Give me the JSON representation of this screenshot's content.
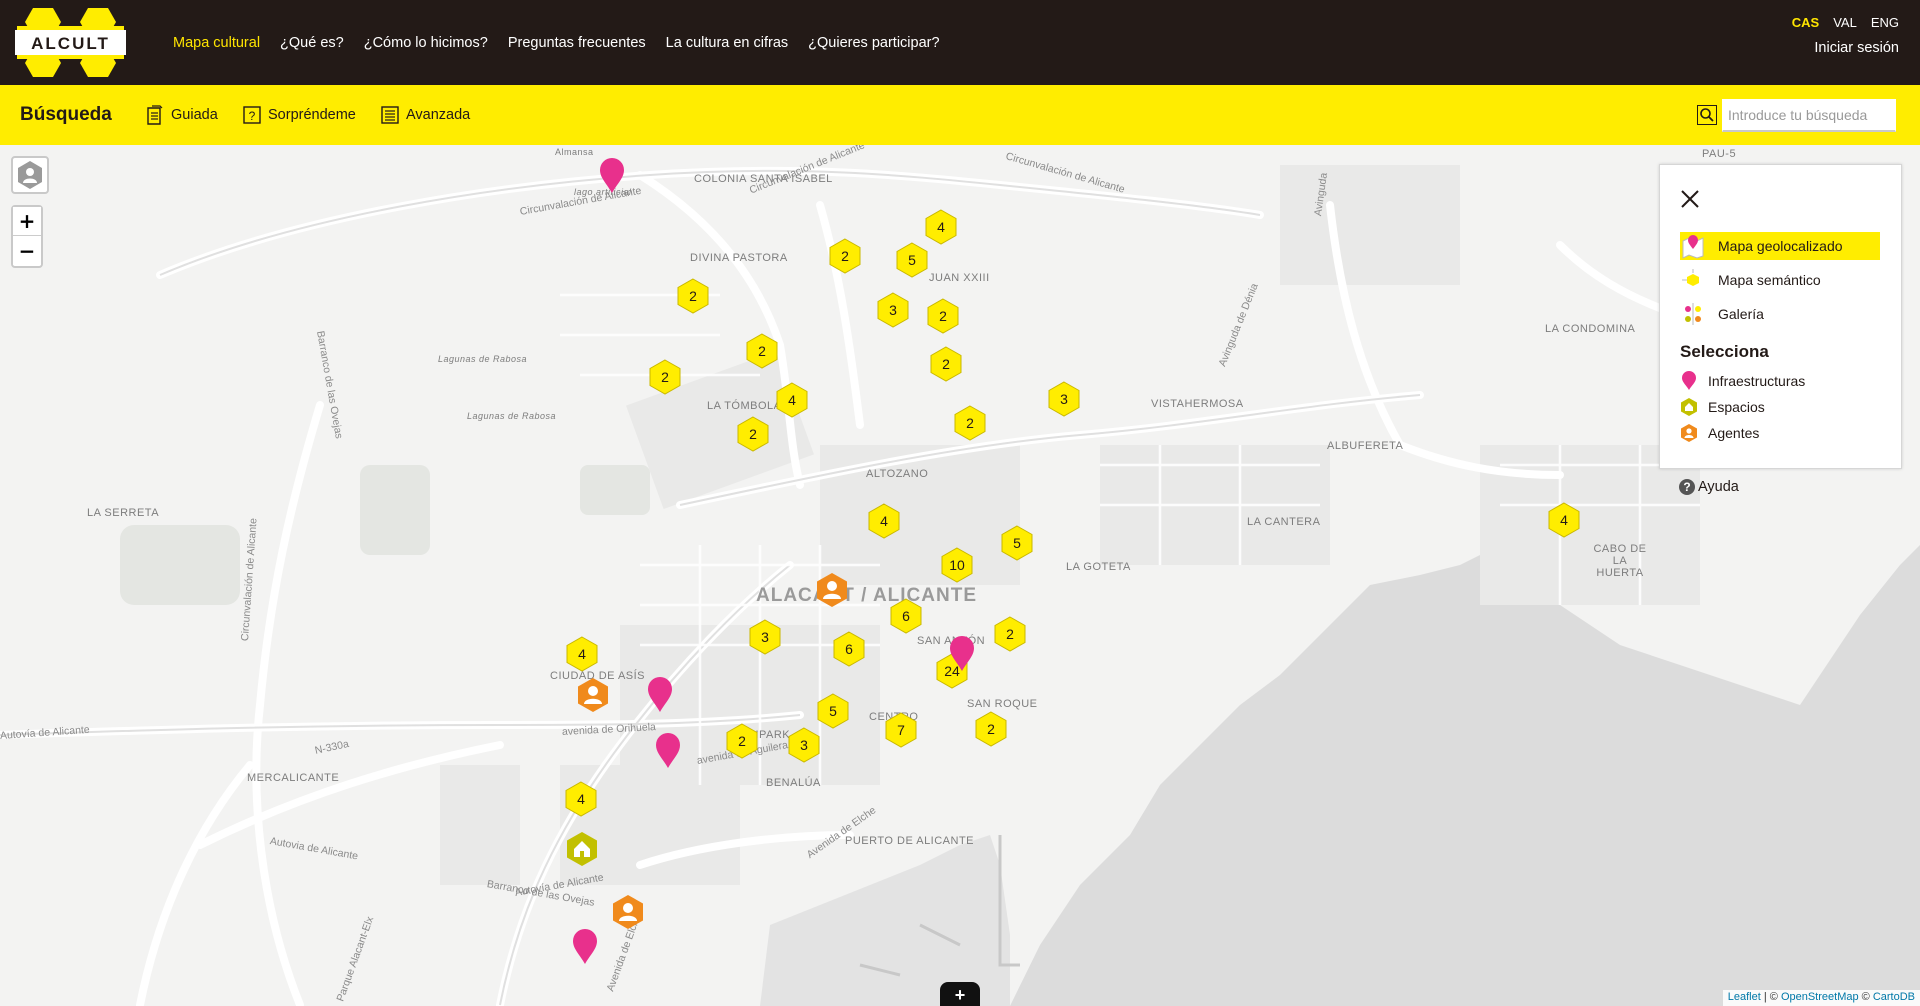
{
  "header": {
    "logo_text": "ALCULT",
    "nav": [
      {
        "label": "Mapa cultural",
        "active": true
      },
      {
        "label": "¿Qué es?",
        "active": false
      },
      {
        "label": "¿Cómo lo hicimos?",
        "active": false
      },
      {
        "label": "Preguntas frecuentes",
        "active": false
      },
      {
        "label": "La cultura en cifras",
        "active": false
      },
      {
        "label": "¿Quieres participar?",
        "active": false
      }
    ],
    "languages": [
      {
        "label": "CAS",
        "active": true
      },
      {
        "label": "VAL",
        "active": false
      },
      {
        "label": "ENG",
        "active": false
      }
    ],
    "login_label": "Iniciar sesión"
  },
  "search": {
    "title": "Búsqueda",
    "modes": [
      "Guiada",
      "Sorpréndeme",
      "Avanzada"
    ],
    "placeholder": "Introduce tu búsqueda",
    "value": ""
  },
  "map": {
    "city_label": "ALACANT / ALICANTE",
    "places": [
      "COLONIA SANTA ISABEL",
      "DIVINA PASTORA",
      "JUAN XXIII",
      "LA TÓMBOLA",
      "ALTOZANO",
      "VISTAHERMOSA",
      "LA CONDOMINA",
      "ALBUFERETA",
      "LA CANTERA",
      "CABO DE LA HUERTA",
      "LA GOTETA",
      "LA SERRETA",
      "CIUDAD DE ASÍS",
      "SAN ANTÓN",
      "SAN ROQUE",
      "CENTRO",
      "ALIPARK",
      "BENALÚA",
      "PUERTO DE ALICANTE",
      "MERCALICANTE",
      "Lagunas de Rabosa",
      "Lagunas de Rabosa",
      "PAU-5",
      "Almansa",
      "lago artificial"
    ],
    "roads": [
      "Circunvalación de Alicante",
      "Circunvalación de Alicante",
      "Circunvalación de Alicante",
      "Avinguda de Dénia",
      "Barranco de las Ovejas",
      "avenida de Orihuela",
      "avenida de Aguilera",
      "Autovía de Alicante",
      "Autovia de Alicante",
      "Autovía de Alicante",
      "Avenida de Elche",
      "Avenida de Elche",
      "N-330a",
      "Parque Alacant-Elx",
      "Barranco de las Ovejas",
      "Circunvalación de Alicante",
      "Avinguda"
    ],
    "clusters": [
      {
        "count": "4"
      },
      {
        "count": "2"
      },
      {
        "count": "5"
      },
      {
        "count": "2"
      },
      {
        "count": "3"
      },
      {
        "count": "2"
      },
      {
        "count": "2"
      },
      {
        "count": "2"
      },
      {
        "count": "2"
      },
      {
        "count": "4"
      },
      {
        "count": "3"
      },
      {
        "count": "2"
      },
      {
        "count": "2"
      },
      {
        "count": "4"
      },
      {
        "count": "10"
      },
      {
        "count": "5"
      },
      {
        "count": "4"
      },
      {
        "count": "6"
      },
      {
        "count": "3"
      },
      {
        "count": "6"
      },
      {
        "count": "2"
      },
      {
        "count": "24"
      },
      {
        "count": "5"
      },
      {
        "count": "7"
      },
      {
        "count": "2"
      },
      {
        "count": "2"
      },
      {
        "count": "3"
      },
      {
        "count": "4"
      },
      {
        "count": "4"
      }
    ],
    "attribution": {
      "leaflet": "Leaflet",
      "osm": "OpenStreetMap",
      "carto": "CartoDB",
      "sep": " | © ",
      "sep2": " © "
    },
    "bottom_tab": "+"
  },
  "panel": {
    "views": [
      {
        "label": "Mapa geolocalizado",
        "active": true
      },
      {
        "label": "Mapa semántico",
        "active": false
      },
      {
        "label": "Galería",
        "active": false
      }
    ],
    "select_title": "Selecciona",
    "legend": [
      {
        "label": "Infraestructuras",
        "color": "#e8308c"
      },
      {
        "label": "Espacios",
        "color": "#c2c000"
      },
      {
        "label": "Agentes",
        "color": "#f08a1c"
      }
    ],
    "help_label": "Ayuda"
  },
  "colors": {
    "accent_yellow": "#ffed00",
    "header_dark": "#231a17",
    "pink": "#e8308c",
    "orange": "#f08a1c",
    "olive": "#c2c000"
  }
}
